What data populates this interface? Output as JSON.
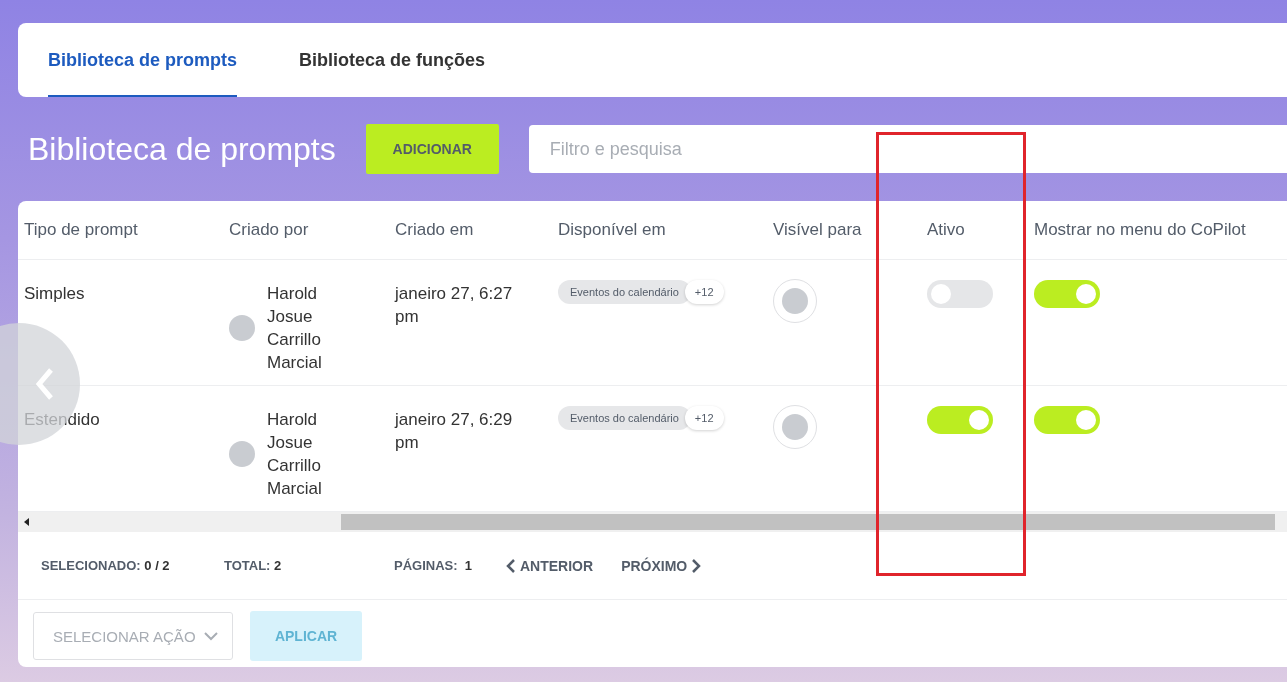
{
  "tabs": [
    {
      "label": "Biblioteca de prompts",
      "selected": true
    },
    {
      "label": "Biblioteca de funções",
      "selected": false
    }
  ],
  "page_title": "Biblioteca de prompts",
  "add_button": "ADICIONAR",
  "search": {
    "placeholder": "Filtro e pesquisa"
  },
  "table": {
    "columns": [
      "Tipo de prompt",
      "Criado por",
      "Criado em",
      "Disponível em",
      "Visível para",
      "Ativo",
      "Mostrar no menu do CoPilot"
    ],
    "rows": [
      {
        "type": "Simples",
        "created_by": "Harold Josue Carrillo Marcial",
        "created_at": "janeiro 27, 6:27 pm",
        "available_in": "Eventos do calendário",
        "available_more": "+12",
        "active": false,
        "show_in_menu": true
      },
      {
        "type": "Estendido",
        "created_by": "Harold Josue Carrillo Marcial",
        "created_at": "janeiro 27, 6:29 pm",
        "available_in": "Eventos do calendário",
        "available_more": "+12",
        "active": true,
        "show_in_menu": true
      }
    ]
  },
  "footer": {
    "selected_label": "SELECIONADO:",
    "selected_value": "0 / 2",
    "total_label": "TOTAL:",
    "total_value": "2",
    "pages_label": "PÁGINAS:",
    "pages_value": "1",
    "prev": "ANTERIOR",
    "next": "PRÓXIMO"
  },
  "actions": {
    "select_placeholder": "SELECIONAR AÇÃO",
    "apply": "APLICAR",
    "apply_disabled": true
  }
}
